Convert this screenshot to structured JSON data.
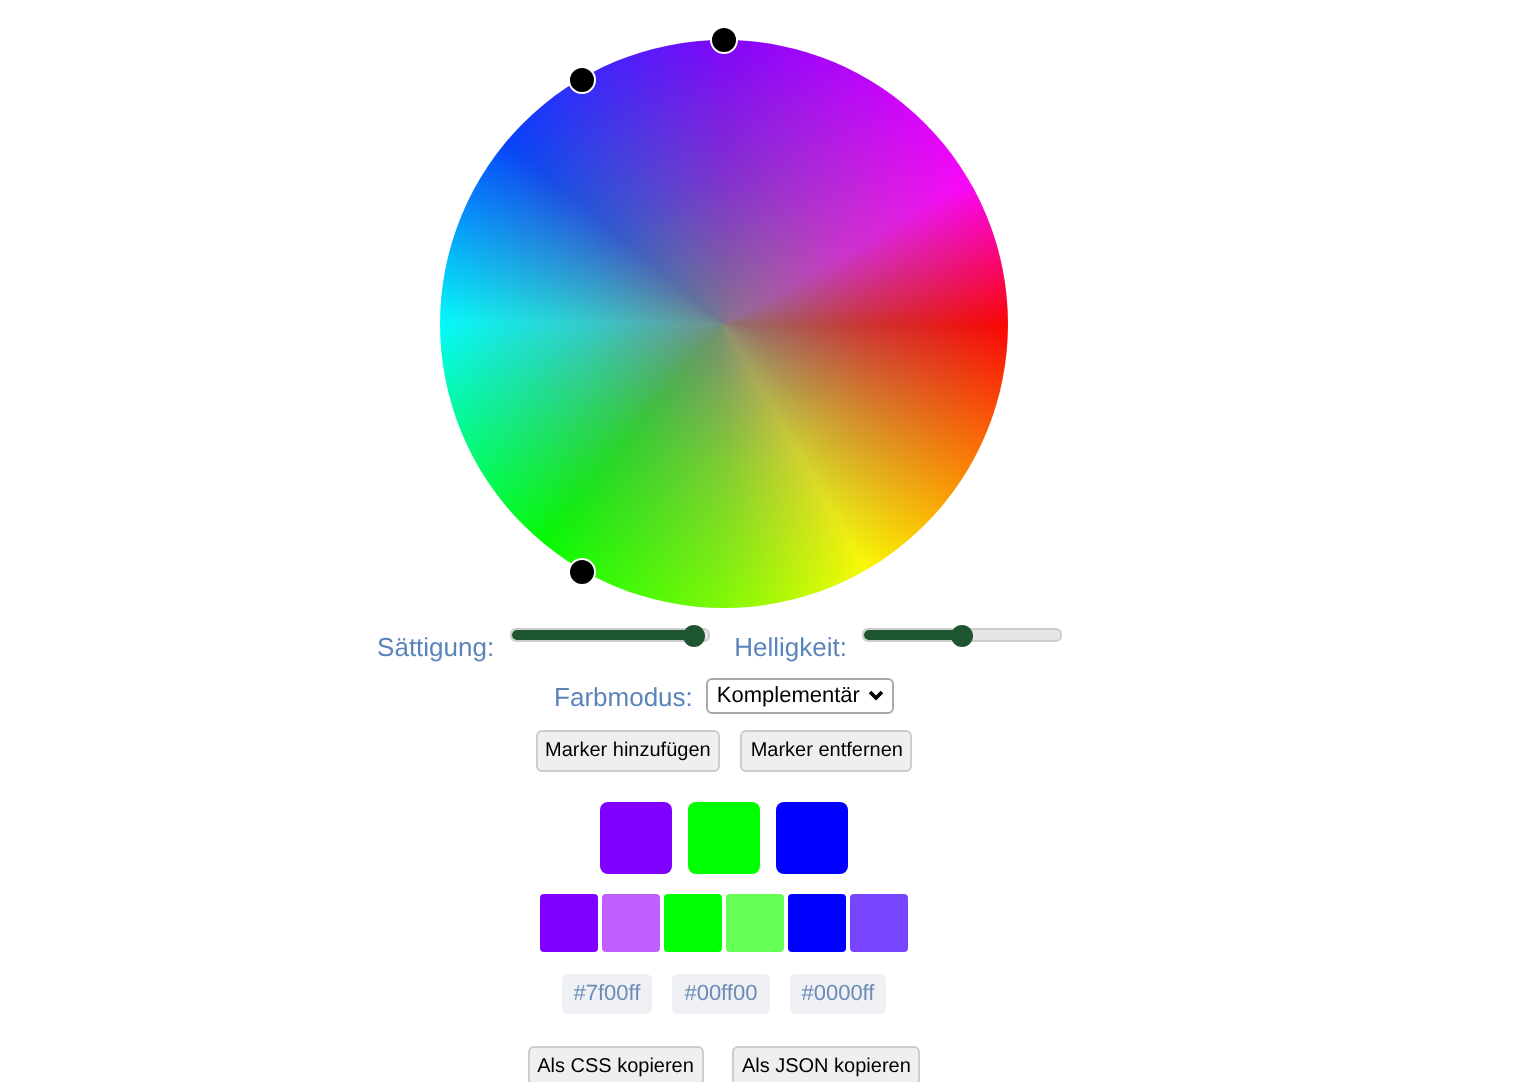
{
  "sliders": [
    {
      "label": "Sättigung:",
      "level": 0.93
    },
    {
      "label": "Helligkeit:",
      "level": 0.5
    }
  ],
  "mode": {
    "label": "Farbmodus:",
    "value": "Komplementär"
  },
  "marker_buttons": [
    "Marker hinzufügen",
    "Marker entfernen"
  ],
  "main_swatches": [
    {
      "color": "#7f00ff"
    },
    {
      "color": "#00ff00"
    },
    {
      "color": "#0000ff"
    }
  ],
  "shade_swatches": [
    {
      "color": "#7f00ff"
    },
    {
      "color": "#bf5fff"
    },
    {
      "color": "#00ff00"
    },
    {
      "color": "#66ff55"
    },
    {
      "color": "#0000ff"
    },
    {
      "color": "#7744ff"
    }
  ],
  "hex_codes": [
    "#7f00ff",
    "#00ff00",
    "#0000ff"
  ],
  "export_buttons": [
    "Als CSS kopieren",
    "Als JSON kopieren"
  ]
}
